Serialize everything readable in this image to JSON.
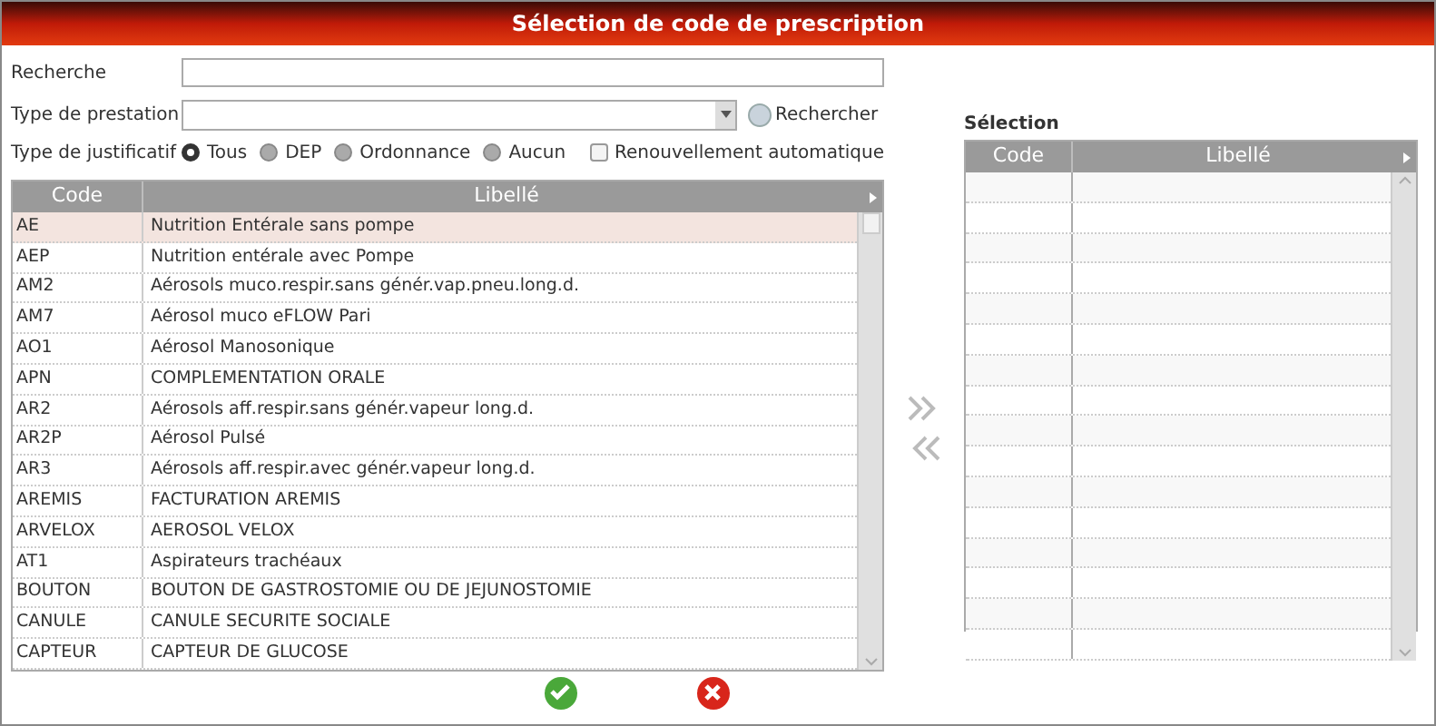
{
  "window": {
    "title": "Sélection de code de prescription"
  },
  "search": {
    "label": "Recherche"
  },
  "prestation": {
    "label": "Type de prestation"
  },
  "search_button": "Rechercher",
  "justificatif": {
    "label": "Type de justificatif",
    "options": [
      {
        "label": "Tous",
        "selected": true
      },
      {
        "label": "DEP",
        "selected": false
      },
      {
        "label": "Ordonnance",
        "selected": false
      },
      {
        "label": "Aucun",
        "selected": false
      }
    ]
  },
  "renewal": {
    "label": "Renouvellement automatique",
    "checked": false
  },
  "table": {
    "columns": [
      "Code",
      "Libellé"
    ],
    "rows": [
      {
        "code": "AE",
        "label": "Nutrition Entérale sans pompe",
        "selected": true
      },
      {
        "code": "AEP",
        "label": "Nutrition entérale avec Pompe",
        "selected": false
      },
      {
        "code": "AM2",
        "label": "Aérosols muco.respir.sans génér.vap.pneu.long.d.",
        "selected": false
      },
      {
        "code": "AM7",
        "label": "Aérosol muco eFLOW Pari",
        "selected": false
      },
      {
        "code": "AO1",
        "label": "Aérosol Manosonique",
        "selected": false
      },
      {
        "code": "APN",
        "label": "COMPLEMENTATION ORALE",
        "selected": false
      },
      {
        "code": "AR2",
        "label": "Aérosols aff.respir.sans génér.vapeur long.d.",
        "selected": false
      },
      {
        "code": "AR2P",
        "label": "Aérosol Pulsé",
        "selected": false
      },
      {
        "code": "AR3",
        "label": "Aérosols aff.respir.avec génér.vapeur long.d.",
        "selected": false
      },
      {
        "code": "AREMIS",
        "label": "FACTURATION AREMIS",
        "selected": false
      },
      {
        "code": "ARVELOX",
        "label": "AEROSOL VELOX",
        "selected": false
      },
      {
        "code": "AT1",
        "label": "Aspirateurs trachéaux",
        "selected": false
      },
      {
        "code": "BOUTON",
        "label": "BOUTON DE GASTROSTOMIE OU DE JEJUNOSTOMIE",
        "selected": false
      },
      {
        "code": "CANULE",
        "label": "CANULE SECURITE SOCIALE",
        "selected": false
      },
      {
        "code": "CAPTEUR",
        "label": "CAPTEUR DE GLUCOSE",
        "selected": false
      }
    ]
  },
  "selection": {
    "title": "Sélection",
    "columns": [
      "Code",
      "Libellé"
    ]
  }
}
